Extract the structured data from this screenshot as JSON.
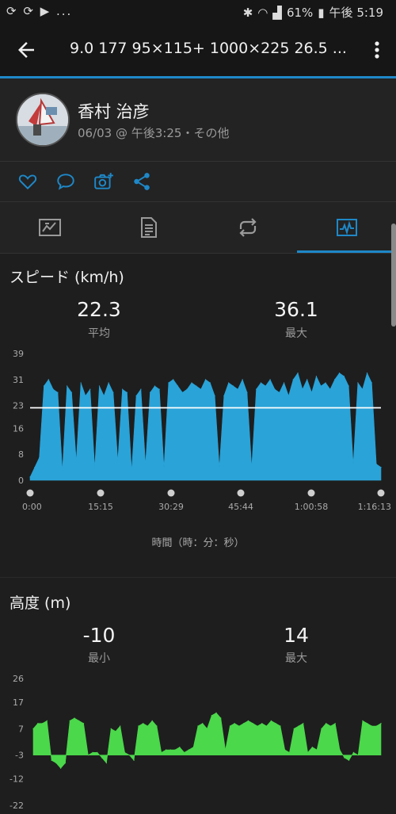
{
  "status": {
    "left_icons": "⟳ ⟳ ▶ ...",
    "battery": "61%",
    "time": "午後 5:19"
  },
  "header": {
    "title": "9.0  177  95×115+    1000×225  26.5 ..."
  },
  "profile": {
    "name": "香村 治彦",
    "subtitle": "06/03 @ 午後3:25・その他"
  },
  "speed": {
    "title": "スピード (km/h)",
    "avg_value": "22.3",
    "avg_label": "平均",
    "max_value": "36.1",
    "max_label": "最大",
    "x_caption": "時間（時：分：秒）"
  },
  "elevation": {
    "title": "高度 (m)",
    "min_value": "-10",
    "min_label": "最小",
    "max_value": "14",
    "max_label": "最大"
  },
  "colors": {
    "accent": "#1e88c8",
    "speed_fill": "#2aa3d8",
    "elev_fill": "#4bd84b"
  },
  "chart_data": [
    {
      "type": "area",
      "title": "スピード (km/h)",
      "xlabel": "時間（時：分：秒）",
      "x_ticks": [
        "0:00",
        "15:15",
        "30:29",
        "45:44",
        "1:00:58",
        "1:16:13"
      ],
      "y_ticks": [
        "39",
        "31",
        "23",
        "16",
        "8",
        "0"
      ],
      "ylim": [
        0,
        39
      ],
      "xlim_minutes": [
        0,
        76.2
      ],
      "average_line": 22.3,
      "x_minutes": [
        0,
        1,
        2,
        3,
        4,
        5,
        6,
        7,
        8,
        9,
        10,
        11,
        12,
        13,
        14,
        15,
        16,
        17,
        18,
        19,
        20,
        21,
        22,
        23,
        24,
        25,
        26,
        27,
        28,
        29,
        30,
        31,
        32,
        33,
        34,
        35,
        36,
        37,
        38,
        39,
        40,
        41,
        42,
        43,
        44,
        45,
        46,
        47,
        48,
        49,
        50,
        51,
        52,
        53,
        54,
        55,
        56,
        57,
        58,
        59,
        60,
        61,
        62,
        63,
        64,
        65,
        66,
        67,
        68,
        69,
        70,
        71,
        72,
        73,
        74,
        75,
        76
      ],
      "values": [
        1,
        4,
        7,
        29,
        31,
        28,
        27,
        3,
        29,
        27,
        6,
        30,
        26,
        28,
        4,
        29,
        26,
        30,
        27,
        6,
        28,
        27,
        3,
        26,
        28,
        5,
        27,
        29,
        28,
        4,
        30,
        31,
        29,
        27,
        28,
        30,
        29,
        28,
        31,
        30,
        26,
        4,
        26,
        30,
        29,
        28,
        31,
        27,
        4,
        28,
        30,
        29,
        31,
        28,
        27,
        30,
        26,
        31,
        33,
        28,
        31,
        27,
        32,
        29,
        30,
        28,
        31,
        33,
        32,
        29,
        5,
        30,
        28,
        33,
        30,
        5,
        4
      ]
    },
    {
      "type": "area",
      "title": "高度 (m)",
      "y_ticks": [
        "26",
        "17",
        "7",
        "-3",
        "-12",
        "-22"
      ],
      "ylim": [
        -22,
        26
      ],
      "x_minutes": [
        0,
        1,
        2,
        3,
        4,
        5,
        6,
        7,
        8,
        9,
        10,
        11,
        12,
        13,
        14,
        15,
        16,
        17,
        18,
        19,
        20,
        21,
        22,
        23,
        24,
        25,
        26,
        27,
        28,
        29,
        30,
        31,
        32,
        33,
        34,
        35,
        36,
        37,
        38,
        39,
        40,
        41,
        42,
        43,
        44,
        45,
        46,
        47,
        48,
        49,
        50,
        51,
        52,
        53,
        54,
        55,
        56,
        57,
        58,
        59,
        60,
        61,
        62,
        63,
        64,
        65,
        66,
        67,
        68,
        69,
        70,
        71,
        72,
        73,
        74,
        75,
        76
      ],
      "values": [
        7,
        9,
        9,
        10,
        -5,
        -6,
        -8,
        -6,
        10,
        11,
        10,
        9,
        -3,
        -2,
        -2,
        -4,
        -6,
        7,
        6,
        8,
        -2,
        -3,
        -5,
        8,
        9,
        8,
        10,
        8,
        -2,
        -1,
        -1,
        -1,
        0,
        -2,
        -1,
        0,
        8,
        9,
        7,
        12,
        13,
        11,
        -1,
        8,
        9,
        8,
        9,
        10,
        9,
        8,
        9,
        8,
        10,
        9,
        8,
        -1,
        -2,
        7,
        8,
        9,
        -2,
        0,
        -1,
        7,
        9,
        8,
        9,
        -1,
        -4,
        -5,
        -2,
        -3,
        10,
        9,
        8,
        8,
        9
      ]
    }
  ]
}
